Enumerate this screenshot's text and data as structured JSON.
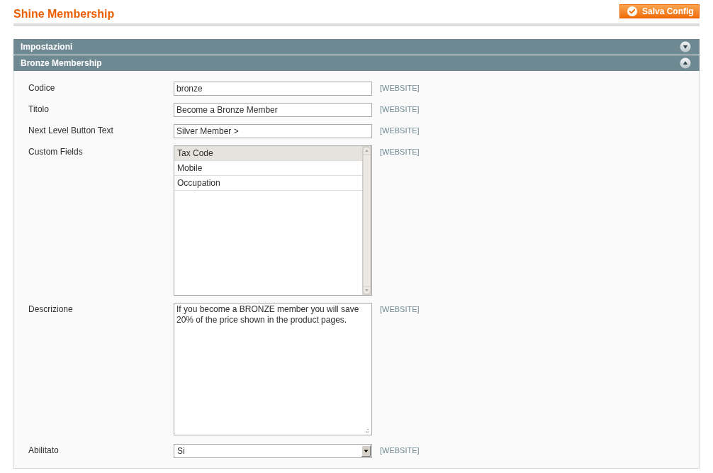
{
  "page": {
    "title": "Shine Membership"
  },
  "save_button": {
    "label": "Salva Config"
  },
  "sections": [
    {
      "title": "Impostazioni",
      "expanded": false
    },
    {
      "title": "Bronze Membership",
      "expanded": true,
      "fields": [
        {
          "kind": "text",
          "label": "Codice",
          "value": "bronze",
          "scope": "[WEBSITE]"
        },
        {
          "kind": "text",
          "label": "Titolo",
          "value": "Become a Bronze Member",
          "scope": "[WEBSITE]"
        },
        {
          "kind": "text",
          "label": "Next Level Button Text",
          "value": "Silver Member >",
          "scope": "[WEBSITE]"
        },
        {
          "kind": "multiselect",
          "label": "Custom Fields",
          "scope": "[WEBSITE]",
          "options": [
            {
              "label": "Tax Code",
              "selected": true
            },
            {
              "label": "Mobile",
              "selected": false
            },
            {
              "label": "Occupation",
              "selected": false
            }
          ]
        },
        {
          "kind": "textarea",
          "label": "Descrizione",
          "value": "If you become a BRONZE member you will save 20% of the price shown in the product pages.",
          "scope": "[WEBSITE]"
        },
        {
          "kind": "select",
          "label": "Abilitato",
          "value": "Si",
          "scope": "[WEBSITE]"
        }
      ]
    }
  ]
}
